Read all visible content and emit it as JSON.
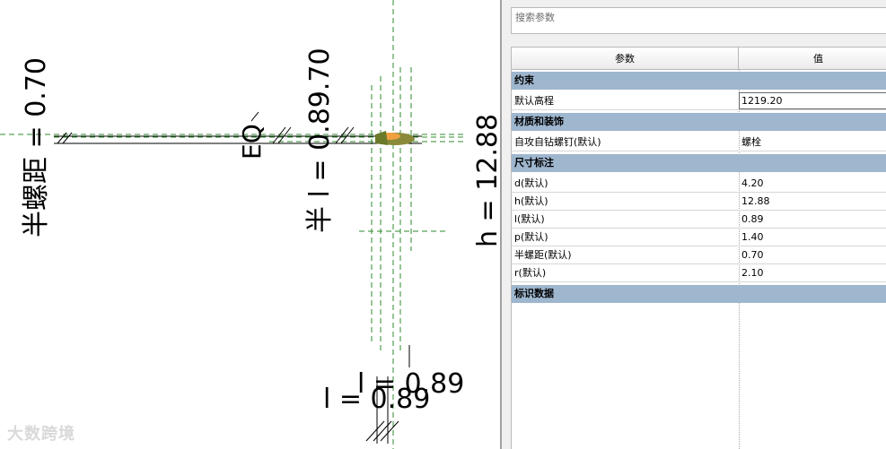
{
  "canvas": {
    "dims": {
      "half_pitch": "半螺距 = 0.70",
      "eq": "EQ",
      "half_l": "半 l = 0.89.70",
      "h": "h = 12.88",
      "l_front": "l = 0.89",
      "l_back": "l = 0.89"
    },
    "watermark": "大数跨境"
  },
  "panel": {
    "search_placeholder": "搜索参数",
    "columns": {
      "param": "参数",
      "value": "值"
    },
    "groups": [
      {
        "title": "约束",
        "rows": [
          {
            "key": "默认高程",
            "value": "1219.20",
            "editing": true
          }
        ]
      },
      {
        "title": "材质和装饰",
        "rows": [
          {
            "key": "自攻自钻螺钉(默认)",
            "value": "螺栓"
          }
        ]
      },
      {
        "title": "尺寸标注",
        "rows": [
          {
            "key": "d(默认)",
            "value": "4.20"
          },
          {
            "key": "h(默认)",
            "value": "12.88"
          },
          {
            "key": "l(默认)",
            "value": "0.89"
          },
          {
            "key": "p(默认)",
            "value": "1.40"
          },
          {
            "key": "半螺距(默认)",
            "value": "0.70"
          },
          {
            "key": "r(默认)",
            "value": "2.10"
          }
        ]
      },
      {
        "title": "标识数据",
        "rows": []
      }
    ]
  },
  "colors": {
    "group_bg": "#9eb6ce",
    "ref_line": "#2e8b2e",
    "screw_body": "#8a8a3a"
  }
}
